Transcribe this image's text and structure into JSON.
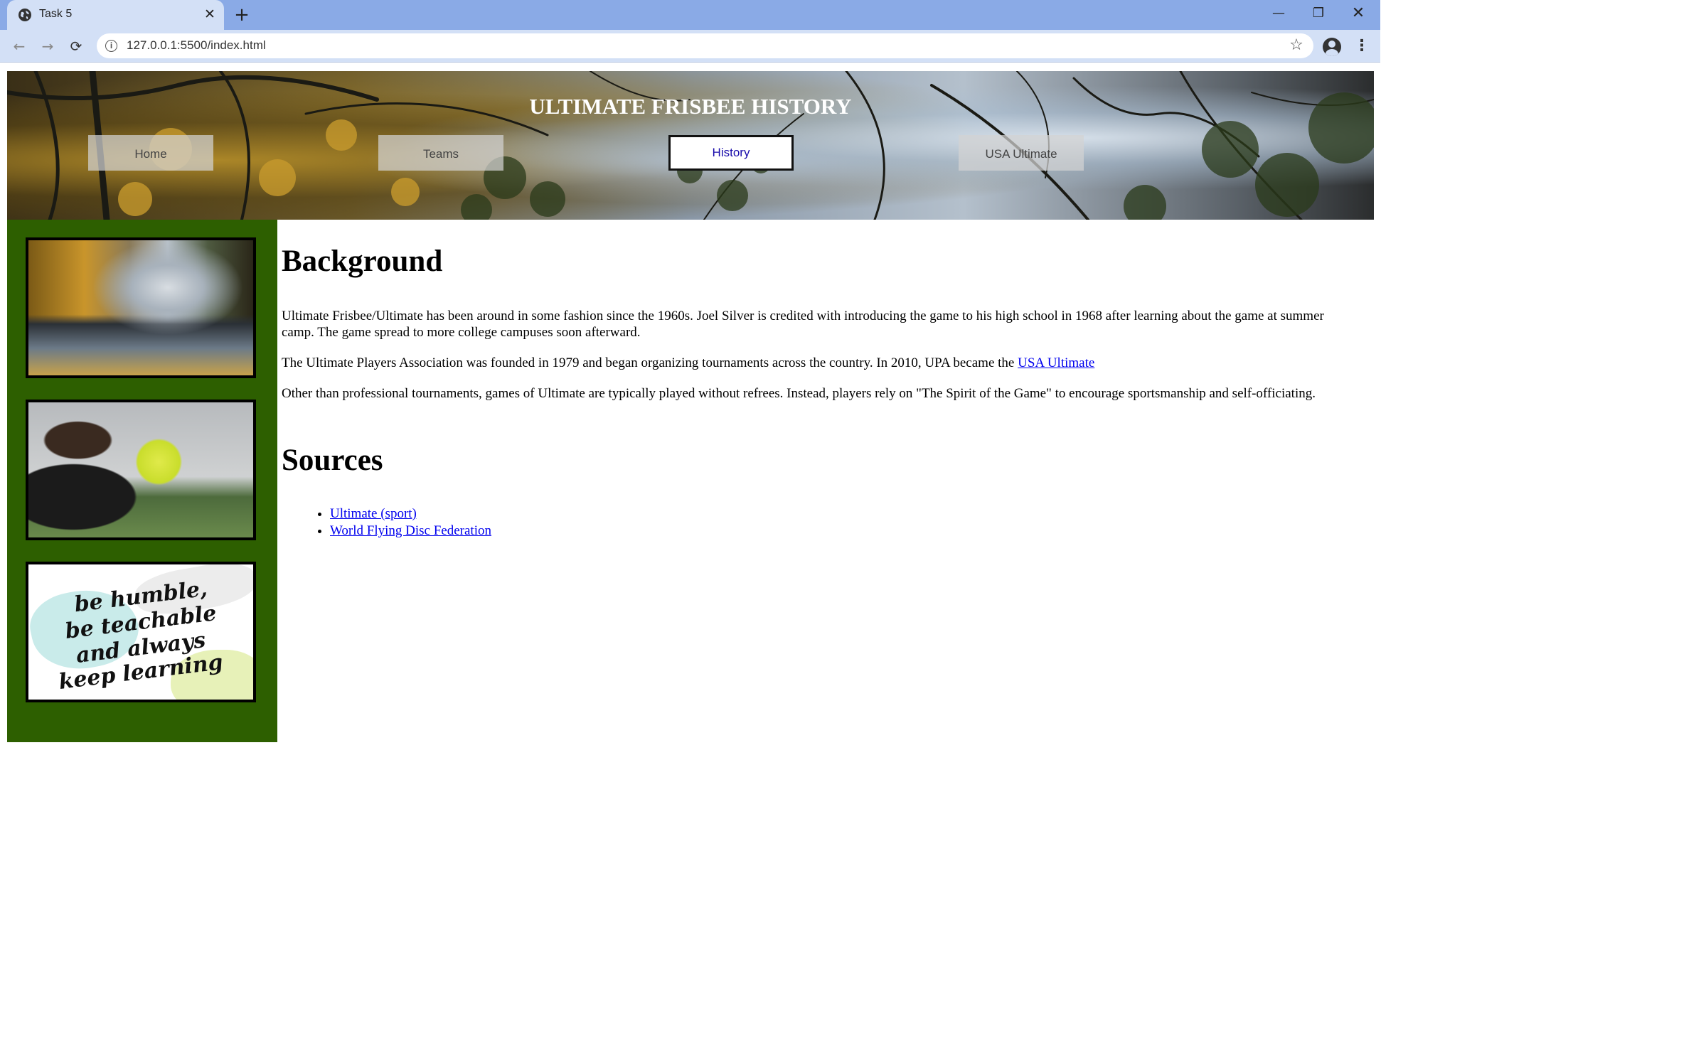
{
  "browser": {
    "tab_title": "Task 5",
    "tab_close": "✕",
    "new_tab": "+",
    "url": "127.0.0.1:5500/index.html",
    "info_glyph": "i",
    "window_controls": {
      "minimize": "—",
      "maximize": "❐",
      "close": "✕"
    },
    "nav": {
      "back": "←",
      "forward": "→",
      "reload": "⟳"
    },
    "star": "☆",
    "menu": "⋮"
  },
  "header": {
    "title": "ULTIMATE FRISBEE HISTORY",
    "nav": [
      {
        "label": "Home"
      },
      {
        "label": "Teams"
      },
      {
        "label": "History"
      },
      {
        "label": "USA Ultimate"
      }
    ],
    "active_nav": "History"
  },
  "sidebar": {
    "quote_lines": [
      "be humble,",
      "be teachable",
      "and always",
      "keep learning"
    ]
  },
  "main": {
    "background_heading": "Background",
    "paragraph1": "Ultimate Frisbee/Ultimate has been around in some fashion since the 1960s. Joel Silver is credited with introducing the game to his high school in 1968 after learning about the game at summer camp. The game spread to more college campuses soon afterward.",
    "paragraph2_text": "The Ultimate Players Association was founded in 1979 and began organizing tournaments across the country. In 2010, UPA became the ",
    "paragraph2_link": "USA Ultimate",
    "paragraph3": "Other than professional tournaments, games of Ultimate are typically played without refrees. Instead, players rely on \"The Spirit of the Game\" to encourage sportsmanship and self-officiating.",
    "sources_heading": "Sources",
    "sources": [
      {
        "label": "Ultimate (sport)"
      },
      {
        "label": "World Flying Disc Federation"
      }
    ]
  },
  "colors": {
    "sidebar_bg": "#2d5f00",
    "link": "#0000ee",
    "browser_frame": "#8aaae6",
    "toolbar": "#d3e0f6"
  }
}
